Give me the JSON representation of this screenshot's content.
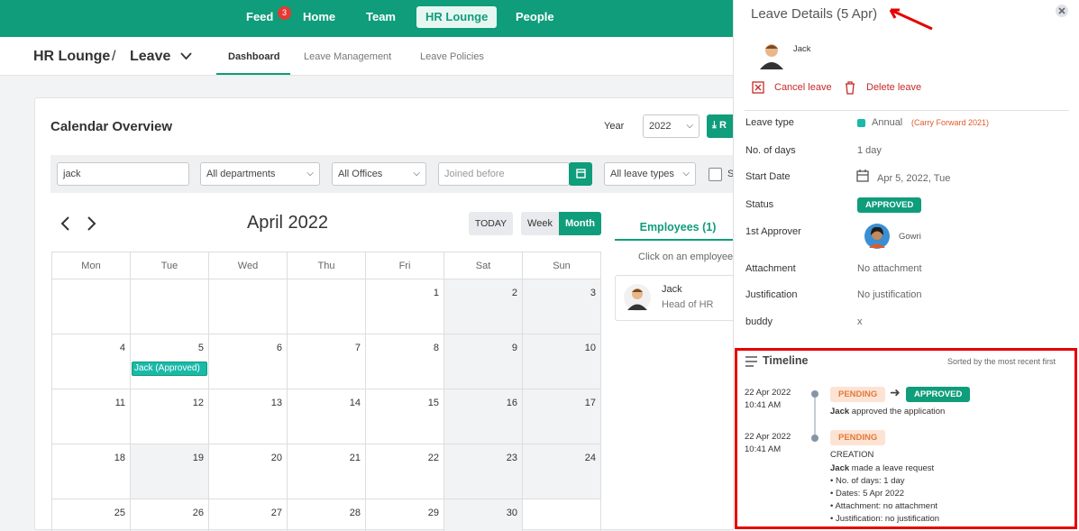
{
  "topnav": {
    "feed": "Feed",
    "feed_badge": "3",
    "home": "Home",
    "team": "Team",
    "hr_lounge": "HR Lounge",
    "people": "People"
  },
  "subbar": {
    "crumb_root": "HR Lounge",
    "crumb_sep": "/",
    "crumb_current": "Leave",
    "tabs": [
      "Dashboard",
      "Leave Management",
      "Leave Policies"
    ]
  },
  "calendar": {
    "title": "Calendar Overview",
    "year_label": "Year",
    "year_value": "2022",
    "report_button": "R",
    "filters": {
      "search_value": "jack",
      "departments": "All departments",
      "offices": "All Offices",
      "joined_placeholder": "Joined before",
      "leave_types": "All leave types",
      "checkbox_label": "S"
    },
    "month_title": "April 2022",
    "today_button": "TODAY",
    "week_button": "Week",
    "month_button": "Month",
    "weekdays": [
      "Mon",
      "Tue",
      "Wed",
      "Thu",
      "Fri",
      "Sat",
      "Sun"
    ],
    "day_numbers": [
      "",
      "",
      "",
      "",
      "1",
      "2",
      "3",
      "4",
      "5",
      "6",
      "7",
      "8",
      "9",
      "10",
      "11",
      "12",
      "13",
      "14",
      "15",
      "16",
      "17",
      "18",
      "19",
      "20",
      "21",
      "22",
      "23",
      "24",
      "25",
      "26",
      "27",
      "28",
      "29",
      "30",
      ""
    ],
    "event": "Jack (Approved)"
  },
  "employees": {
    "tab": "Employees (1)",
    "hint": "Click on an employee",
    "name": "Jack",
    "role": "Head of HR"
  },
  "details": {
    "title": "Leave Details (5 Apr)",
    "employee": "Jack",
    "cancel": "Cancel leave",
    "delete": "Delete leave",
    "rows": {
      "leave_type_label": "Leave type",
      "leave_type_value": "Annual",
      "leave_type_note": "(Carry Forward 2021)",
      "days_label": "No. of days",
      "days_value": "1 day",
      "start_label": "Start Date",
      "start_value": "Apr 5, 2022, Tue",
      "status_label": "Status",
      "status_value": "APPROVED",
      "approver_label": "1st Approver",
      "approver_value": "Gowri",
      "attachment_label": "Attachment",
      "attachment_value": "No attachment",
      "justification_label": "Justification",
      "justification_value": "No justification",
      "buddy_label": "buddy",
      "buddy_value": "x"
    },
    "colors": {
      "accent": "#0f9d7b",
      "danger": "#c62828",
      "highlight": "#e60000"
    }
  },
  "timeline": {
    "title": "Timeline",
    "sort_note": "Sorted by the most recent first",
    "entries": [
      {
        "date": "22 Apr 2022",
        "time": "10:41 AM",
        "from": "PENDING",
        "to": "APPROVED",
        "actor": "Jack",
        "text": "approved the application"
      },
      {
        "date": "22 Apr 2022",
        "time": "10:41 AM",
        "status": "PENDING",
        "heading": "CREATION",
        "actor": "Jack",
        "text": "made a leave request",
        "bullets": [
          "No. of days: 1 day",
          "Dates: 5 Apr 2022",
          "Attachment: no attachment",
          "Justification: no justification"
        ]
      }
    ]
  }
}
